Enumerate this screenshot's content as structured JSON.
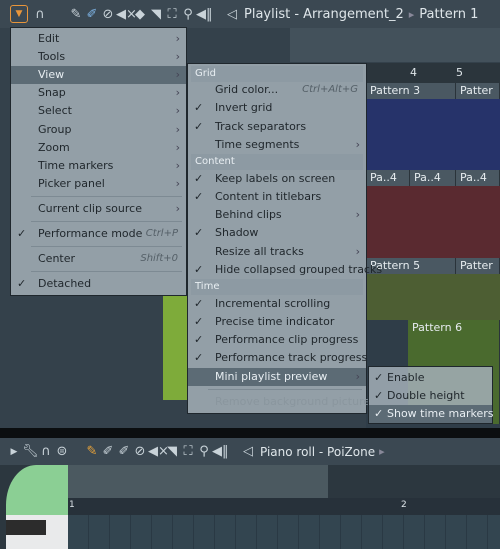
{
  "toolbar": {
    "title": "Playlist - Arrangement_2",
    "pattern": "Pattern 1",
    "icons": [
      "menu-arrow-icon",
      "magnet-icon",
      "pencil-icon",
      "paint-brush-icon",
      "delete-icon",
      "mute-icon",
      "slip-icon",
      "slice-icon",
      "select-icon",
      "zoom-icon",
      "playback-icon",
      "speaker-icon"
    ]
  },
  "timeline": {
    "markers": [
      "4",
      "5"
    ]
  },
  "clips": {
    "p3": "Pattern 3",
    "p3b": "Patter",
    "p4a": "Pa..4",
    "p4b": "Pa..4",
    "p4c": "Pa..4",
    "p5": "Pattern 5",
    "p5b": "Patter",
    "p6": "Pattern 6"
  },
  "menu_main": {
    "items": [
      {
        "label": "Edit",
        "arrow": true
      },
      {
        "label": "Tools",
        "arrow": true
      },
      {
        "label": "View",
        "arrow": true,
        "highlighted": true
      },
      {
        "label": "Snap",
        "arrow": true
      },
      {
        "label": "Select",
        "arrow": true
      },
      {
        "label": "Group",
        "arrow": true
      },
      {
        "label": "Zoom",
        "arrow": true
      },
      {
        "label": "Time markers",
        "arrow": true
      },
      {
        "label": "Picker panel",
        "arrow": true
      },
      {
        "label": "Current clip source",
        "arrow": true
      },
      {
        "label": "Performance mode",
        "shortcut": "Ctrl+P",
        "checked": true
      },
      {
        "label": "Center",
        "shortcut": "Shift+0"
      },
      {
        "label": "Detached",
        "checked": true
      }
    ]
  },
  "menu_view": {
    "grid_header": "Grid",
    "content_header": "Content",
    "time_header": "Time",
    "items": [
      {
        "label": "Grid color...",
        "shortcut": "Ctrl+Alt+G"
      },
      {
        "label": "Invert grid",
        "checked": true
      },
      {
        "label": "Track separators",
        "checked": true
      },
      {
        "label": "Time segments",
        "arrow": true
      },
      {
        "label": "Keep labels on screen",
        "checked": true
      },
      {
        "label": "Content in titlebars",
        "checked": true
      },
      {
        "label": "Behind clips",
        "arrow": true
      },
      {
        "label": "Shadow",
        "checked": true
      },
      {
        "label": "Resize all tracks",
        "arrow": true
      },
      {
        "label": "Hide collapsed grouped tracks",
        "checked": true
      },
      {
        "label": "Incremental scrolling",
        "checked": true
      },
      {
        "label": "Precise time indicator",
        "checked": true
      },
      {
        "label": "Performance clip progress",
        "checked": true
      },
      {
        "label": "Performance track progress",
        "checked": true
      },
      {
        "label": "Mini playlist preview",
        "arrow": true,
        "highlighted": true
      },
      {
        "label": "Remove background picture",
        "disabled": true
      }
    ]
  },
  "menu_preview": {
    "items": [
      {
        "label": "Enable",
        "checked": true
      },
      {
        "label": "Double height",
        "checked": true
      },
      {
        "label": "Show time markers",
        "checked": true,
        "highlighted": true
      }
    ]
  },
  "piano_roll": {
    "title": "Piano roll - PoiZone",
    "ruler": [
      "1",
      "2"
    ]
  },
  "check_glyph": "✓",
  "arrow_glyph": "›",
  "colors": {
    "blue_track": "#26336a",
    "red_track": "#5a2a30",
    "green_track": "#4d5e33",
    "accent": "#e8953a"
  }
}
